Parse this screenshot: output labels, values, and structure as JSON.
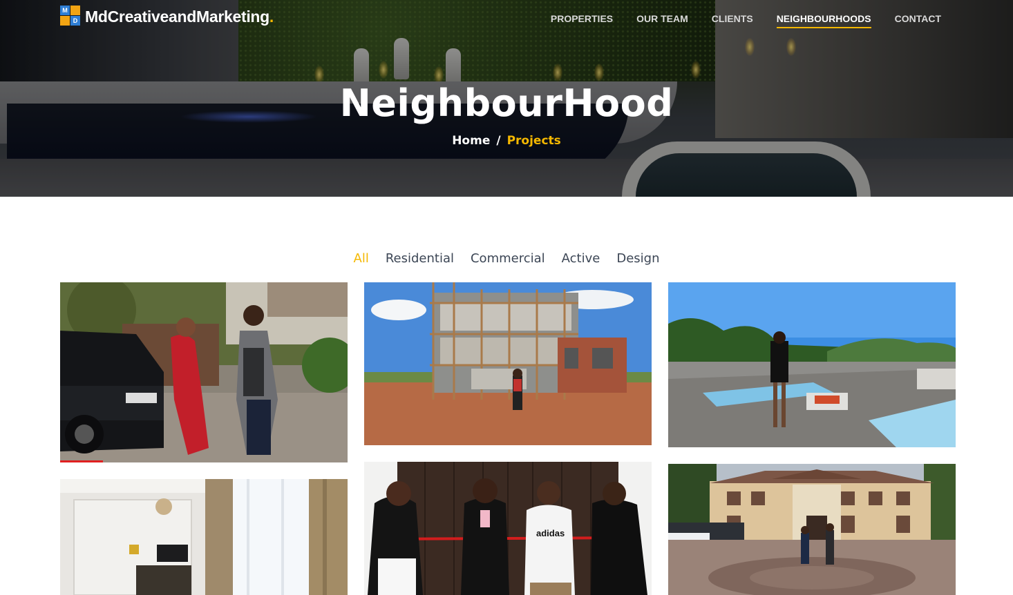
{
  "brand": {
    "name": "MdCreativeandMarketing",
    "dot": ".",
    "mark_letters": [
      "M",
      "",
      "",
      "D"
    ]
  },
  "nav": {
    "items": [
      {
        "label": "PROPERTIES",
        "active": false
      },
      {
        "label": "OUR TEAM",
        "active": false
      },
      {
        "label": "CLIENTS",
        "active": false
      },
      {
        "label": "NEIGHBOURHOODS",
        "active": true
      },
      {
        "label": "CONTACT",
        "active": false
      }
    ]
  },
  "hero": {
    "title": "NeighbourHood",
    "breadcrumb": {
      "home": "Home",
      "separator": "/",
      "current": "Projects"
    }
  },
  "filters": {
    "items": [
      {
        "label": "All",
        "active": true
      },
      {
        "label": "Residential",
        "active": false
      },
      {
        "label": "Commercial",
        "active": false
      },
      {
        "label": "Active",
        "active": false
      },
      {
        "label": "Design",
        "active": false
      }
    ]
  },
  "colors": {
    "accent": "#f5b800",
    "text": "#3c4655",
    "video_progress": "#e02020"
  },
  "gallery": {
    "items": [
      {
        "name": "couple-car-photo",
        "video_progress": 0.15
      },
      {
        "name": "construction-site-photo"
      },
      {
        "name": "rooftop-pool-photo"
      },
      {
        "name": "interior-living-room-photo"
      },
      {
        "name": "ribbon-cutting-photo"
      },
      {
        "name": "mansion-exterior-photo"
      }
    ]
  }
}
